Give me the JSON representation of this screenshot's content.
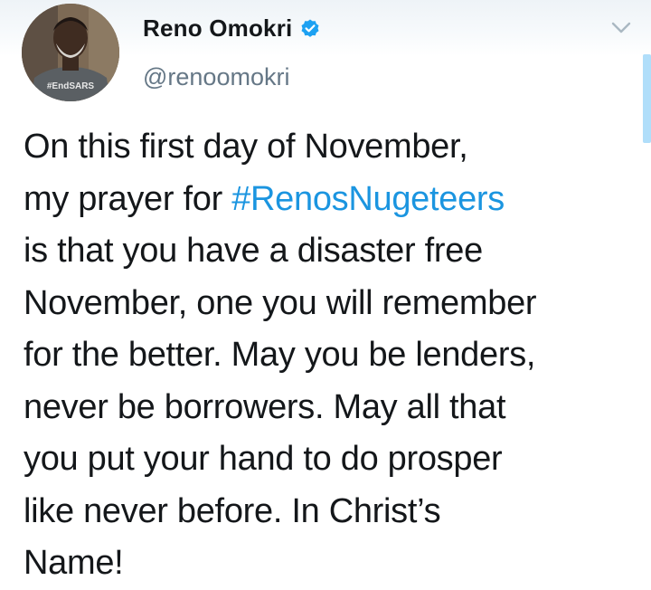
{
  "author": {
    "display_name": "Reno Omokri",
    "handle": "@renoomokri",
    "verified": true,
    "avatar_shirt_text": "#EndSARS"
  },
  "tweet": {
    "line1": "On this first day of November,",
    "line2_before": "my prayer for ",
    "hashtag": "#RenosNugeteers",
    "line3": "is that you have a disaster free",
    "line4": "November, one you will remember",
    "line5": "for the better. May you be lenders,",
    "line6": "never be borrowers. May all that",
    "line7": "you put your hand to do prosper",
    "line8": "like never before. In Christ’s",
    "line9": "Name!"
  },
  "icons": {
    "verified": "verified-badge-icon",
    "menu": "chevron-down-icon"
  },
  "colors": {
    "accent": "#1da1f2",
    "hashtag": "#1b95e0",
    "text": "#14171a",
    "secondary": "#657786"
  }
}
